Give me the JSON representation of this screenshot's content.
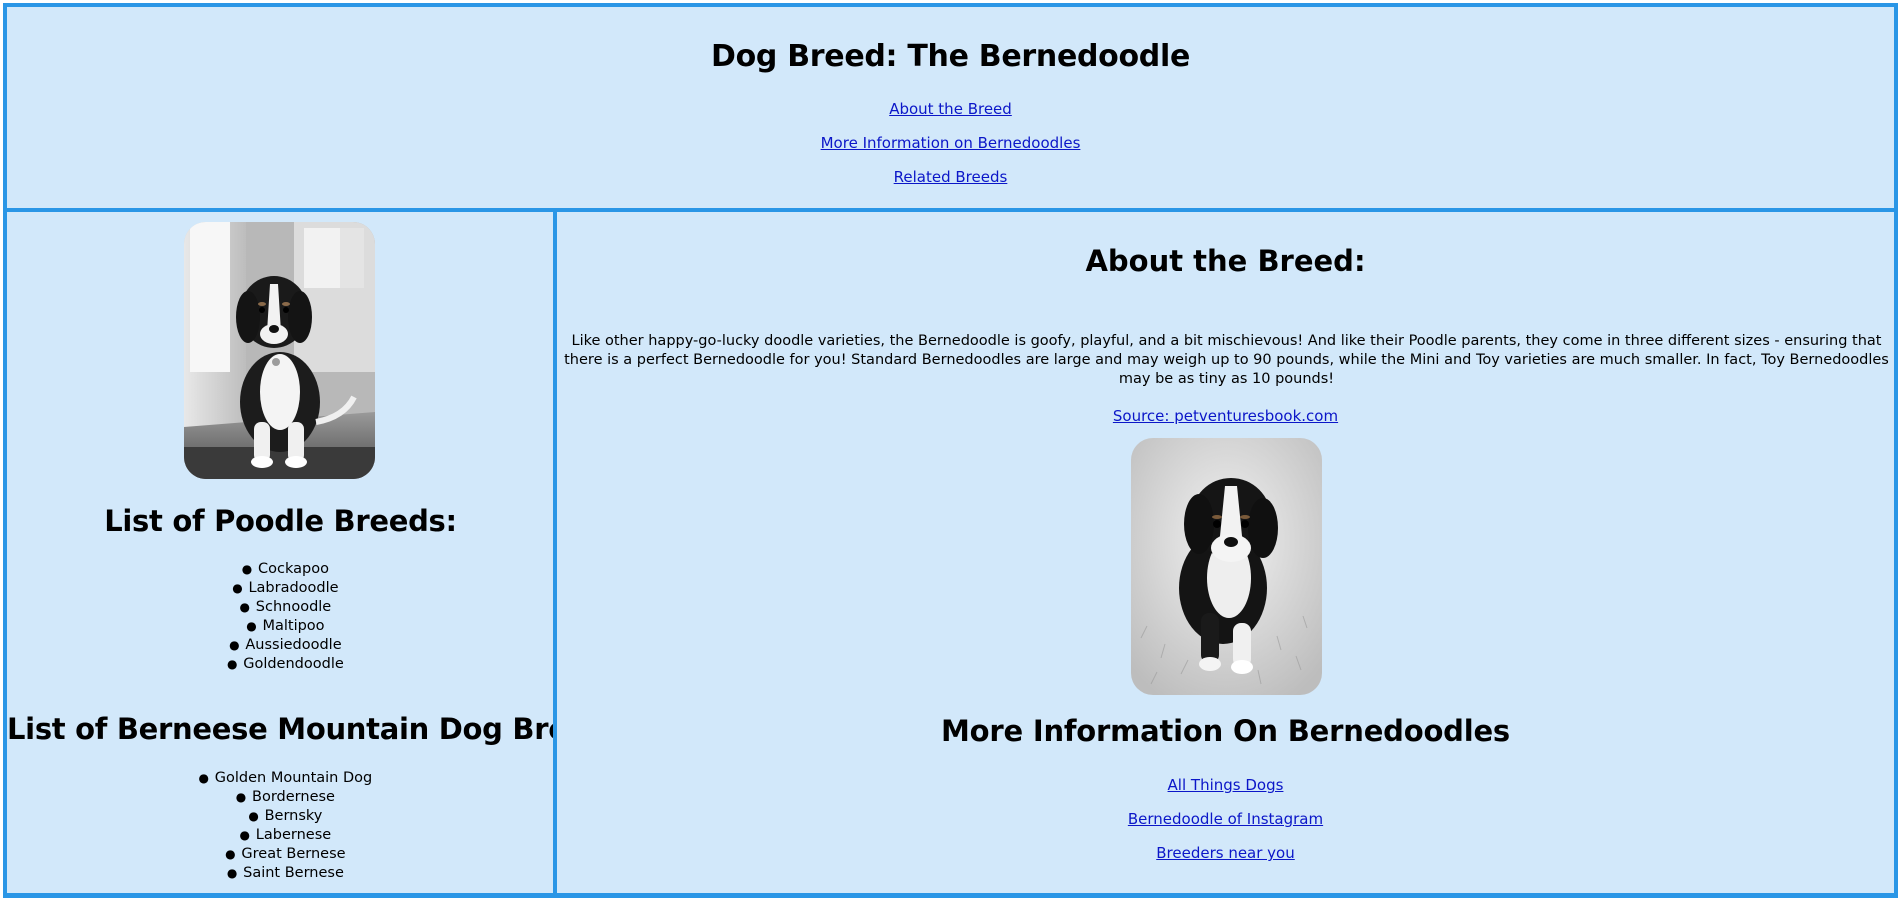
{
  "header": {
    "title": "Dog Breed: The Bernedoodle",
    "nav": [
      "About the Breed",
      "More Information on Bernedoodles",
      "Related Breeds"
    ]
  },
  "sidebar": {
    "photo_alt": "Bernedoodle puppy sitting by a door",
    "poodle_heading": "List of Poodle Breeds:",
    "poodle_breeds": [
      "Cockapoo",
      "Labradoodle",
      "Schnoodle",
      "Maltipoo",
      "Aussiedoodle",
      "Goldendoodle"
    ],
    "bernese_heading": "List of Berneese Mountain Dog Breeds:",
    "bernese_breeds": [
      "Golden Mountain Dog",
      "Bordernese",
      "Bernsky",
      "Labernese",
      "Great Bernese",
      "Saint Bernese"
    ]
  },
  "main": {
    "about_heading": "About the Breed:",
    "about_text": "Like other happy-go-lucky doodle varieties, the Bernedoodle is goofy, playful, and a bit mischievous! And like their Poodle parents, they come in three different sizes - ensuring that there is a perfect Bernedoodle for you! Standard Bernedoodles are large and may weigh up to 90 pounds, while the Mini and Toy varieties are much smaller. In fact, Toy Bernedoodles may be as tiny as 10 pounds!",
    "source_link": "Source: petventuresbook.com",
    "photo_alt": "Bernedoodle puppy walking in the grass",
    "more_heading": "More Information On Bernedoodles",
    "more_links": [
      "All Things Dogs",
      "Bernedoodle of Instagram",
      "Breeders near you"
    ]
  },
  "colors": {
    "panel_background": "#d2e8fa",
    "border": "#2a96e6",
    "link": "#0b16c8"
  }
}
